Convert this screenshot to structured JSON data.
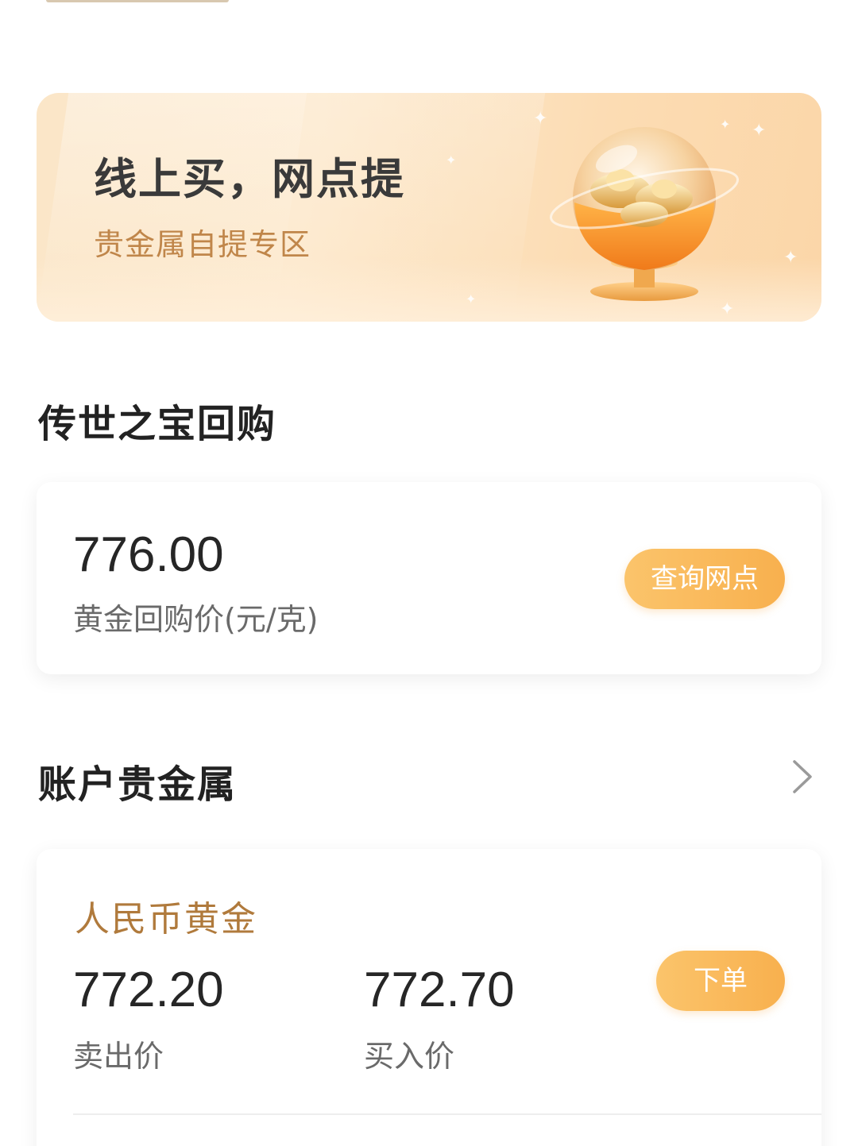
{
  "banner": {
    "title": "线上买，网点提",
    "subtitle": "贵金属自提专区"
  },
  "heirloom": {
    "section_title": "传世之宝回购",
    "price": "776.00",
    "price_label": "黄金回购价(元/克)",
    "button_label": "查询网点"
  },
  "account": {
    "section_title": "账户贵金属",
    "product_name": "人民币黄金",
    "sell_price": "772.20",
    "sell_label": "卖出价",
    "buy_price": "772.70",
    "buy_label": "买入价",
    "order_button_label": "下单"
  },
  "colors": {
    "accent": "#f8b04e",
    "gold_text": "#b07a3c"
  },
  "icons": {
    "banner_illustration": "gold-ingot-globe-icon",
    "chevron": "chevron-right-icon"
  }
}
